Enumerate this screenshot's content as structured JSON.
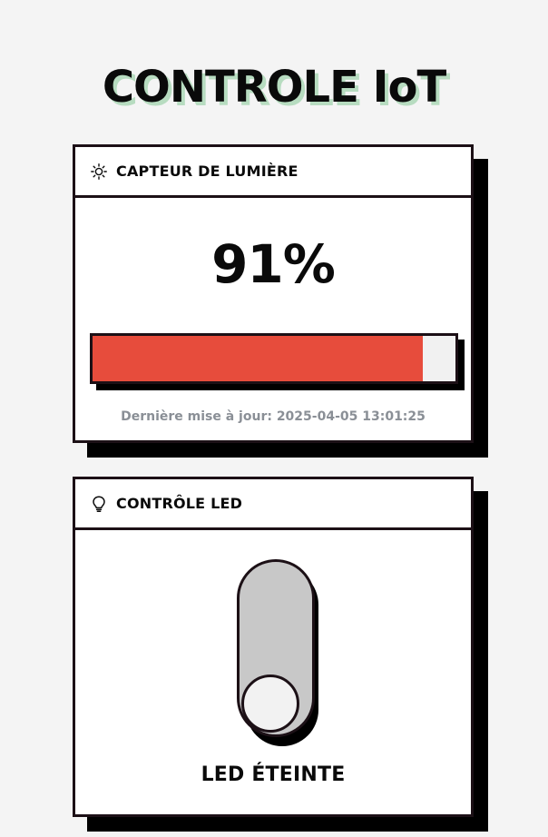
{
  "title": "CONTROLE IoT",
  "colors": {
    "background": "#f4f4f4",
    "card": "#ffffff",
    "border": "#1c1016",
    "shadow": "#000000",
    "title_shadow": "#b7dcc0",
    "bar_fill": "#e74c3c",
    "bar_track": "#f1f1f1",
    "toggle_off": "#c8c8c8",
    "muted_text": "#8a8f96"
  },
  "sensor": {
    "icon": "sun-icon",
    "header": "CAPTEUR DE LUMIÈRE",
    "value_text": "91%",
    "level_percent": 91,
    "last_update": "Dernière mise à jour: 2025-04-05 13:01:25"
  },
  "led": {
    "icon": "lightbulb-icon",
    "header": "CONTRÔLE LED",
    "state": "off",
    "status_text": "LED ÉTEINTE"
  }
}
